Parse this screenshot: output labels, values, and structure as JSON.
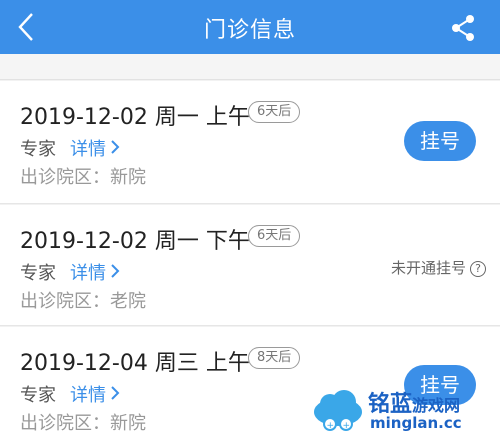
{
  "header": {
    "title": "门诊信息",
    "back_icon": "back-arrow-icon",
    "share_icon": "share-icon",
    "background": "#3b8fe8"
  },
  "schedules": [
    {
      "date": "2019-12-02 周一 上午",
      "badge": "6天后",
      "type": "专家",
      "detail": "详情",
      "campus": "出诊院区：新院",
      "action": "挂号"
    },
    {
      "date": "2019-12-02 周一 下午",
      "badge": "6天后",
      "type": "专家",
      "detail": "详情",
      "campus": "出诊院区：老院",
      "status": "未开通挂号",
      "status_icon": "question-icon"
    },
    {
      "date": "2019-12-04 周三 上午",
      "badge": "8天后",
      "type": "专家",
      "detail": "详情",
      "campus": "出诊院区：新院",
      "action": "挂号"
    }
  ],
  "watermark": {
    "name": "铭蓝",
    "sub": "游戏网",
    "url": "minglan.cc"
  },
  "colors": {
    "accent": "#3b8fe8",
    "watermark": "#1b62c4"
  }
}
